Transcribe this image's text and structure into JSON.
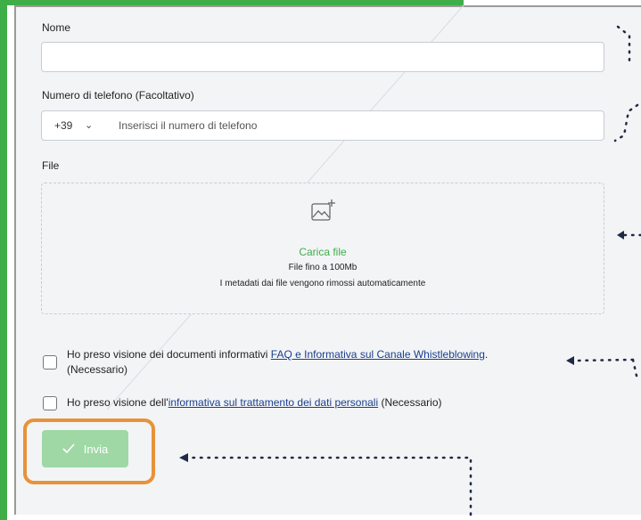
{
  "form": {
    "name_label": "Nome",
    "name_value": "",
    "phone_label": "Numero di telefono (Facoltativo)",
    "phone_prefix": "+39",
    "phone_placeholder": "Inserisci il numero di telefono",
    "file_label": "File",
    "upload_title": "Carica file",
    "upload_limit": "File fino a 100Mb",
    "upload_meta_note": "I metadati dai file vengono rimossi automaticamente",
    "consent1_text_before": "Ho preso visione dei documenti informativi ",
    "consent1_link": "FAQ e Informativa sul Canale Whistleblowing",
    "consent1_text_after": ".",
    "consent1_required": "(Necessario)",
    "consent2_text_before": "Ho preso visione dell'",
    "consent2_link": "informativa sul trattamento dei dati personali",
    "consent2_text_after": " (Necessario)",
    "submit_label": "Invia"
  },
  "colors": {
    "accent_green": "#3fae49",
    "submit_disabled": "#9fd8a5",
    "highlight_orange": "#e8923a",
    "annotation_navy": "#1f2a44"
  },
  "icons": {
    "chevron": "chevron-down-icon",
    "upload": "image-upload-icon",
    "check": "check-icon"
  }
}
